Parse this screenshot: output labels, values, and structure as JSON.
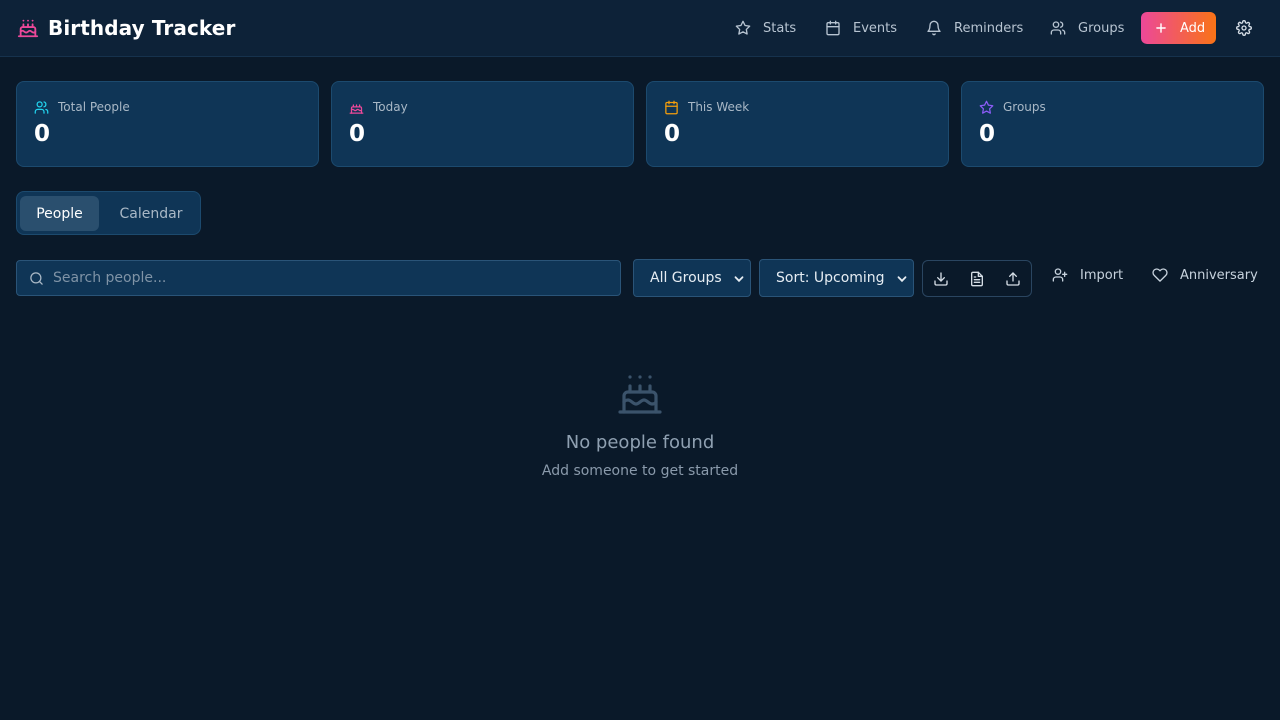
{
  "header": {
    "title": "Birthday Tracker",
    "nav": [
      {
        "label": "Stats",
        "icon": "star-icon"
      },
      {
        "label": "Events",
        "icon": "calendar-icon"
      },
      {
        "label": "Reminders",
        "icon": "bell-icon"
      },
      {
        "label": "Groups",
        "icon": "users-icon"
      }
    ],
    "add_label": "Add"
  },
  "stats": [
    {
      "label": "Total People",
      "value": "0",
      "icon": "users-icon",
      "color": "#22d3ee"
    },
    {
      "label": "Today",
      "value": "0",
      "icon": "cake-icon",
      "color": "#ec4899"
    },
    {
      "label": "This Week",
      "value": "0",
      "icon": "calendar-icon",
      "color": "#f59e0b"
    },
    {
      "label": "Groups",
      "value": "0",
      "icon": "star-icon",
      "color": "#8b5cf6"
    }
  ],
  "tabs": [
    {
      "label": "People",
      "active": true
    },
    {
      "label": "Calendar",
      "active": false
    }
  ],
  "toolbar": {
    "search_placeholder": "Search people...",
    "group_filter": "All Groups",
    "sort": "Sort: Upcoming",
    "import_label": "Import",
    "anniversary_label": "Anniversary"
  },
  "empty_state": {
    "title": "No people found",
    "subtitle": "Add someone to get started"
  },
  "colors": {
    "background": "#0a1929",
    "card": "#0f3556",
    "accent_start": "#ec4899",
    "accent_end": "#f97316"
  }
}
